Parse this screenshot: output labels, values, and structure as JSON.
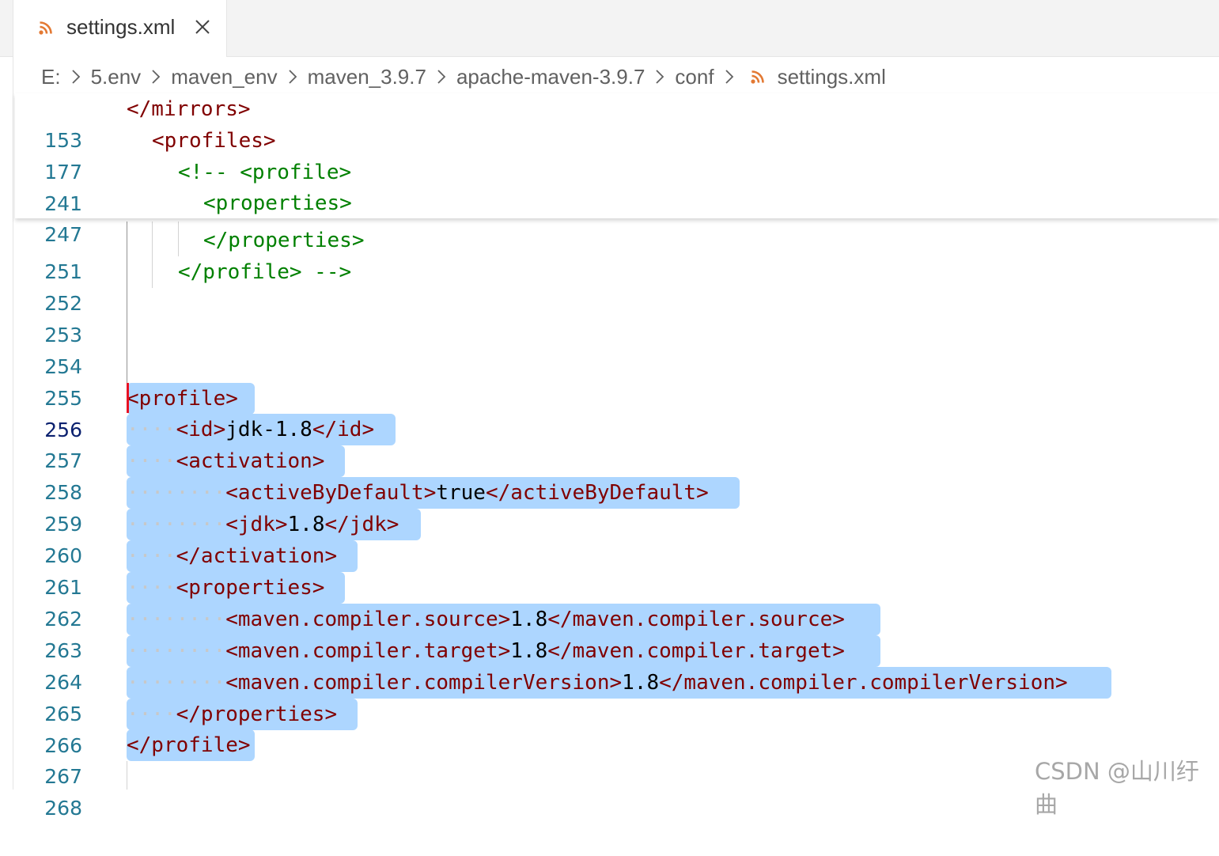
{
  "tab": {
    "label": "settings.xml",
    "close_symbol": "×"
  },
  "breadcrumb": {
    "items": [
      "E:",
      "5.env",
      "maven_env",
      "maven_3.9.7",
      "apache-maven-3.9.7",
      "conf"
    ],
    "file": "settings.xml"
  },
  "sticky": [
    {
      "ln": "153",
      "code": "</mirrors>"
    },
    {
      "ln": "177",
      "code": "<profiles>"
    },
    {
      "ln": "241",
      "code": "<!-- <profile>"
    },
    {
      "ln": "247",
      "code": "<properties>"
    }
  ],
  "lines": {
    "l251": {
      "ln": "251",
      "code": "</properties>"
    },
    "l252": {
      "ln": "252",
      "code": "</profile> -->"
    },
    "l253": {
      "ln": "253"
    },
    "l254": {
      "ln": "254"
    },
    "l255": {
      "ln": "255"
    },
    "l256": {
      "ln": "256",
      "code": "<profile>"
    },
    "l257": {
      "ln": "257",
      "ws": "····",
      "open": "<id>",
      "text": "jdk-1.8",
      "close": "</id>"
    },
    "l258": {
      "ln": "258",
      "ws": "····",
      "code": "<activation>"
    },
    "l259": {
      "ln": "259",
      "ws": "········",
      "open": "<activeByDefault>",
      "text": "true",
      "close": "</activeByDefault>"
    },
    "l260": {
      "ln": "260",
      "ws": "········",
      "open": "<jdk>",
      "text": "1.8",
      "close": "</jdk>"
    },
    "l261": {
      "ln": "261",
      "ws": "····",
      "code": "</activation>"
    },
    "l262": {
      "ln": "262",
      "ws": "····",
      "code": "<properties>"
    },
    "l263": {
      "ln": "263",
      "ws": "········",
      "open": "<maven.compiler.source>",
      "text": "1.8",
      "close": "</maven.compiler.source>"
    },
    "l264": {
      "ln": "264",
      "ws": "········",
      "open": "<maven.compiler.target>",
      "text": "1.8",
      "close": "</maven.compiler.target>"
    },
    "l265": {
      "ln": "265",
      "ws": "········",
      "open": "<maven.compiler.compilerVersion>",
      "text": "1.8",
      "close": "</maven.compiler.compilerVersion>"
    },
    "l266": {
      "ln": "266",
      "ws": "····",
      "code": "</properties>"
    },
    "l267": {
      "ln": "267",
      "code": "</profile>"
    },
    "l268": {
      "ln": "268"
    }
  },
  "watermark": "CSDN @山川纡曲",
  "colors": {
    "tag": "#800000",
    "comment": "#008000",
    "line_number": "#237893",
    "selection": "#add6ff",
    "cursor": "#e81123",
    "file_icon": "#e37933"
  },
  "icons": [
    "rss-file-icon",
    "close-icon",
    "chevron-right-icon"
  ]
}
